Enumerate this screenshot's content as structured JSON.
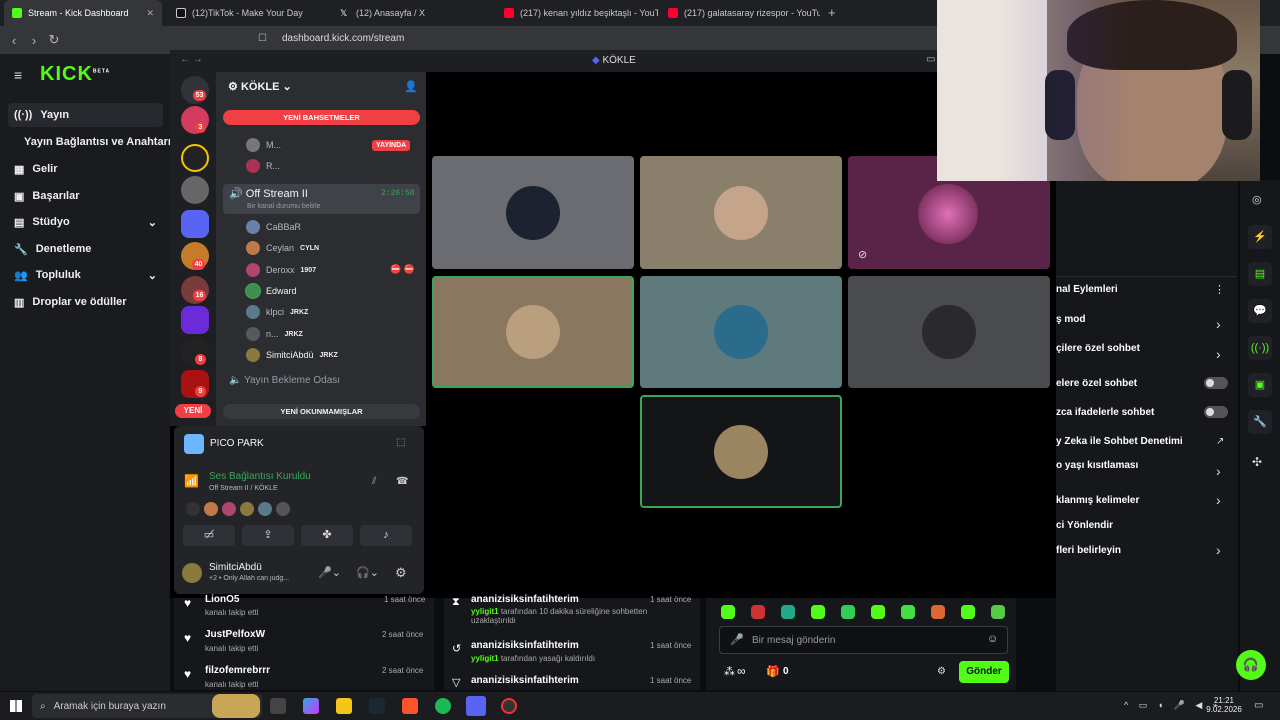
{
  "browser": {
    "tabs": [
      {
        "title": "Stream - Kick Dashboard",
        "color": "#53fc18"
      },
      {
        "title": "(12)TikTok - Make Your Day",
        "color": "#eeeeee"
      },
      {
        "title": "(12) Anasayfa / X",
        "color": "#eeeeee"
      },
      {
        "title": "(217) kenan yıldız beşiktaşlı - YouTube",
        "color": "#ff0033"
      },
      {
        "title": "(217) galatasaray rizespor - YouTube",
        "color": "#ff0033"
      }
    ],
    "new_tab": "+",
    "url": "dashboard.kick.com/stream"
  },
  "kick": {
    "logo": "KICK",
    "logo_badge": "BETA",
    "nav": [
      {
        "label": "Yayın",
        "icon": "broadcast-icon"
      },
      {
        "label": "Yayın Bağlantısı ve Anahtarı",
        "icon": ""
      },
      {
        "label": "Gelir",
        "icon": "revenue-icon"
      },
      {
        "label": "Başarılar",
        "icon": "achievements-icon"
      },
      {
        "label": "Stüdyo",
        "icon": "studio-icon",
        "chevron": "⌄"
      },
      {
        "label": "Denetleme",
        "icon": "wrench-icon"
      },
      {
        "label": "Topluluk",
        "icon": "community-icon",
        "chevron": "⌄"
      },
      {
        "label": "Droplar ve ödüller",
        "icon": "drops-icon"
      }
    ]
  },
  "discord": {
    "window_title": "KÖKLE",
    "server_name": "KÖKLE",
    "server_badges": [
      "53",
      "3",
      "40",
      "16",
      "8",
      "9"
    ],
    "new_label": "YENİ",
    "new_mentions": "YENİ BAHSETMELER",
    "new_unread": "YENİ OKUNMAMIŞLAR",
    "live_badge": "YAYINDA",
    "top_members": [
      {
        "name": "M..."
      },
      {
        "name": "R..."
      }
    ],
    "voice_channel": {
      "name": "Off Stream II",
      "timer": "2:26:58",
      "status": "Bir kanal durumu belirle"
    },
    "members": [
      {
        "name": "CaBBaR",
        "tag": "",
        "color": "#6b7fa8"
      },
      {
        "name": "Ceylan",
        "tag": "CYLN",
        "color": "#c07a4a"
      },
      {
        "name": "Deroxx",
        "tag": "1907",
        "color": "#b0456e"
      },
      {
        "name": "Edward",
        "tag": "",
        "color": "#3e8f4e"
      },
      {
        "name": "klpci",
        "tag": "JRKZ",
        "color": "#5a7a8c"
      },
      {
        "name": "n...",
        "tag": "JRKZ",
        "color": "#555a60"
      },
      {
        "name": "SimitciAbdü",
        "tag": "JRKZ",
        "color": "#8a7a3e"
      }
    ],
    "waiting_room": "Yayın Bekleme Odası",
    "activity": "PICO PARK",
    "connection": {
      "title": "Ses Bağlantısı Kuruldu",
      "sub": "Off Stream II / KÖKLE"
    },
    "user": {
      "name": "SimitciAbdü",
      "status": "+2 • Only Allah can judg..."
    },
    "tiles": [
      {
        "bg": "#6a6c72",
        "av": "#1c2230",
        "border": "none"
      },
      {
        "bg": "#8a7f6a",
        "av": "#c4a48a",
        "border": "none"
      },
      {
        "bg": "#5a2448",
        "av": "#b04a88",
        "border": "none"
      },
      {
        "bg": "#8a7760",
        "av": "#b99f7d",
        "border": "#3ba55c"
      },
      {
        "bg": "#5f7a7d",
        "av": "#2b6b8c",
        "border": "none"
      },
      {
        "bg": "#4a4b4f",
        "av": "#2a2a2d",
        "border": "none"
      },
      {
        "bg": "#141516",
        "av": "#9a8560",
        "border": "#3ba55c"
      }
    ]
  },
  "feed_left": [
    {
      "name": "LionO5",
      "action": "kanalı takip etti",
      "time": "1 saat önce"
    },
    {
      "name": "JustPelfoxW",
      "action": "kanalı takip etti",
      "time": "2 saat önce"
    },
    {
      "name": "filzofemrebrrr",
      "action": "kanalı takip etti",
      "time": "2 saat önce"
    }
  ],
  "feed_mid": [
    {
      "name": "ananizisiksinfatihterim",
      "user": "yyligit1",
      "text": "tarafından 10 dakika süreliğine sohbetten uzaklaştırıldı",
      "time": "1 saat önce"
    },
    {
      "name": "ananizisiksinfatihterim",
      "user": "yyligit1",
      "text": "tarafından yasağı kaldırıldı",
      "time": "1 saat önce"
    },
    {
      "name": "ananizisiksinfatihterim",
      "time": "1 saat önce"
    }
  ],
  "chat": {
    "placeholder": "Bir mesaj gönderin",
    "send": "Gönder",
    "points": "0",
    "infinity": "∞"
  },
  "right_panel": {
    "title": "nal Eylemleri",
    "items": [
      {
        "label": "ş mod",
        "type": "chevron"
      },
      {
        "label": "çilere özel sohbet",
        "type": "chevron"
      },
      {
        "label": "elere özel sohbet",
        "type": "toggle"
      },
      {
        "label": "zca ifadelerle sohbet",
        "type": "toggle"
      },
      {
        "label": "y Zeka ile Sohbet Denetimi",
        "type": "link"
      },
      {
        "label": "o yaşı kısıtlaması",
        "type": "chevron"
      },
      {
        "label": "klanmış kelimeler",
        "type": "chevron"
      },
      {
        "label": "ci Yönlendir",
        "type": "none"
      },
      {
        "label": "fleri belirleyin",
        "type": "chevron"
      }
    ]
  },
  "taskbar": {
    "search": "Aramak için buraya yazın",
    "time": "21:21",
    "date": "9.02.2026"
  }
}
